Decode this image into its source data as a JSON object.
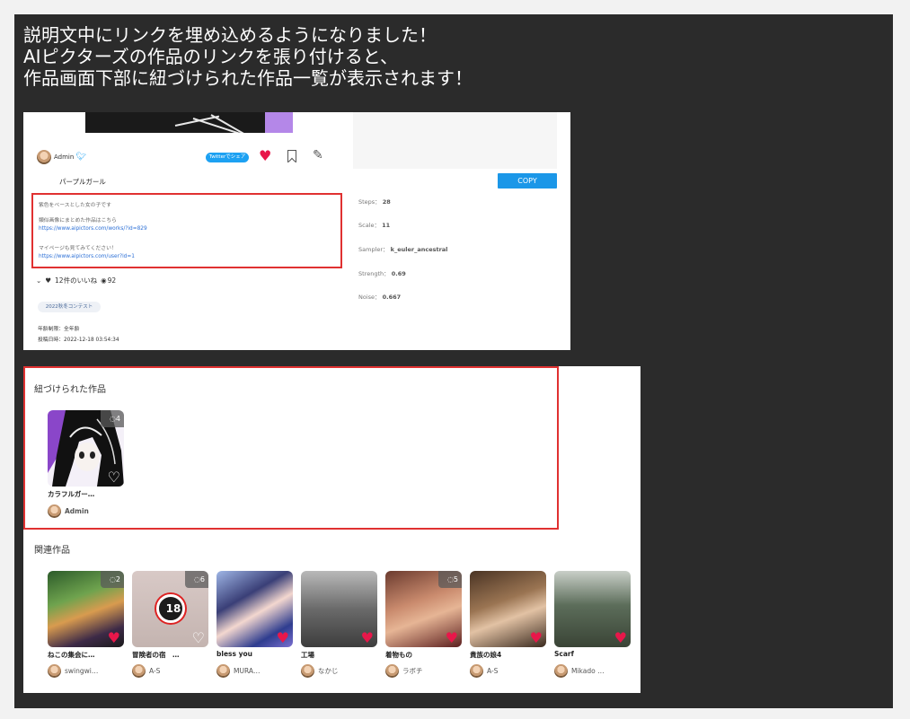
{
  "caption": {
    "line1": "説明文中にリンクを埋め込めるようになりました！",
    "line2": "AIピクターズの作品のリンクを張り付けると、",
    "line3": "作品画面下部に紐づけられた作品一覧が表示されます！"
  },
  "work": {
    "author": "Admin",
    "twitter_share_label": "Twitterでシェア",
    "title": "パープルガール",
    "description": [
      "紫色をベースとした女の子です",
      "類似画像にまとめた作品はこちら",
      "https://www.aipictors.com/works/?id=829",
      "マイページも見てみてください！",
      "https://www.aipictors.com/user?id=1"
    ],
    "likes_label": "12件のいいね",
    "views": "92",
    "tag": "2022秋冬コンテスト",
    "age_rating": "年齢制限：全年齢",
    "posted_at": "投稿日時：2022-12-18 03:54:34"
  },
  "params": {
    "copy_label": "COPY",
    "items": [
      {
        "label": "Steps：",
        "value": "28"
      },
      {
        "label": "Scale：",
        "value": "11"
      },
      {
        "label": "Sampler：",
        "value": "k_euler_ancestral"
      },
      {
        "label": "Strength：",
        "value": "0.69"
      },
      {
        "label": "Noise：",
        "value": "0.667"
      }
    ]
  },
  "linked": {
    "section_title": "紐づけられた作品",
    "items": [
      {
        "title": "カラフルガー…",
        "author": "Admin",
        "badge": "4"
      }
    ]
  },
  "related": {
    "section_title": "関連作品",
    "items": [
      {
        "title": "ねこの集会に…",
        "author": "swingwi…",
        "badge": "2",
        "liked": true
      },
      {
        "title": "冒険者の宿　…",
        "author": "A-S",
        "badge": "6",
        "liked": false,
        "rating": "18"
      },
      {
        "title": "bless you",
        "author": "MURA…",
        "badge": "",
        "liked": true
      },
      {
        "title": "工場",
        "author": "なかじ",
        "badge": "",
        "liked": true
      },
      {
        "title": "着物もの",
        "author": "ラボチ",
        "badge": "5",
        "liked": true
      },
      {
        "title": "貴族の娘4",
        "author": "A-S",
        "badge": "",
        "liked": true
      },
      {
        "title": "Scarf",
        "author": "Mikado …",
        "badge": "",
        "liked": true
      }
    ]
  },
  "colors": {
    "accent_red": "#e03131",
    "like_heart": "#e8174a",
    "copy_button": "#1b97e8",
    "twitter": "#1da1f2"
  },
  "icons": {
    "chevron": "chevron-down-icon",
    "heart": "heart-icon",
    "eye": "eye-icon",
    "bookmark": "bookmark-icon",
    "pencil": "pencil-icon",
    "comment": "comment-icon"
  }
}
